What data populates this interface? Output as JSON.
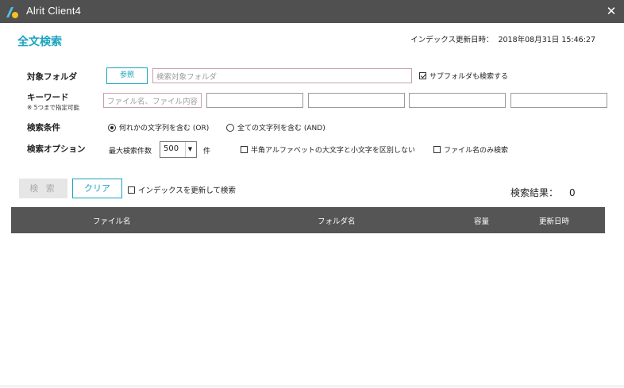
{
  "window": {
    "title": "Alrit Client4",
    "accent_color": "#1aa3c0",
    "titlebar_color": "#505050",
    "close_icon": "close-icon"
  },
  "header": {
    "page_title": "全文検索",
    "index_label": "インデックス更新日時：",
    "index_value": "2018年08月31日 15:46:27"
  },
  "target_folder": {
    "label": "対象フォルダ",
    "browse_label": "参照",
    "placeholder": "検索対象フォルダ",
    "subfolder_label": "サブフォルダも検索する",
    "subfolder_checked": true
  },
  "keyword": {
    "label": "キーワード",
    "note": "※ 5つまで指定可能",
    "first_placeholder": "ファイル名、ファイル内容",
    "values": [
      "",
      "",
      "",
      "",
      ""
    ]
  },
  "conditions": {
    "label": "検索条件",
    "options": [
      "何れかの文字列を含む (OR)",
      "全ての文字列を含む (AND)"
    ],
    "selected_index": 0
  },
  "search_options": {
    "label": "検索オプション",
    "max_label": "最大検索件数",
    "max_value": "500",
    "max_unit": "件",
    "case_label": "半角アルファベットの大文字と小文字を区別しない",
    "case_checked": false,
    "filename_only_label": "ファイル名のみ検索",
    "filename_only_checked": false
  },
  "actions": {
    "search_label": "検 索",
    "clear_label": "クリア",
    "update_index_label": "インデックスを更新して検索",
    "update_index_checked": false
  },
  "results": {
    "label": "検索結果：",
    "count": "0",
    "columns": [
      "ファイル名",
      "フォルダ名",
      "容量",
      "更新日時"
    ],
    "rows": []
  }
}
